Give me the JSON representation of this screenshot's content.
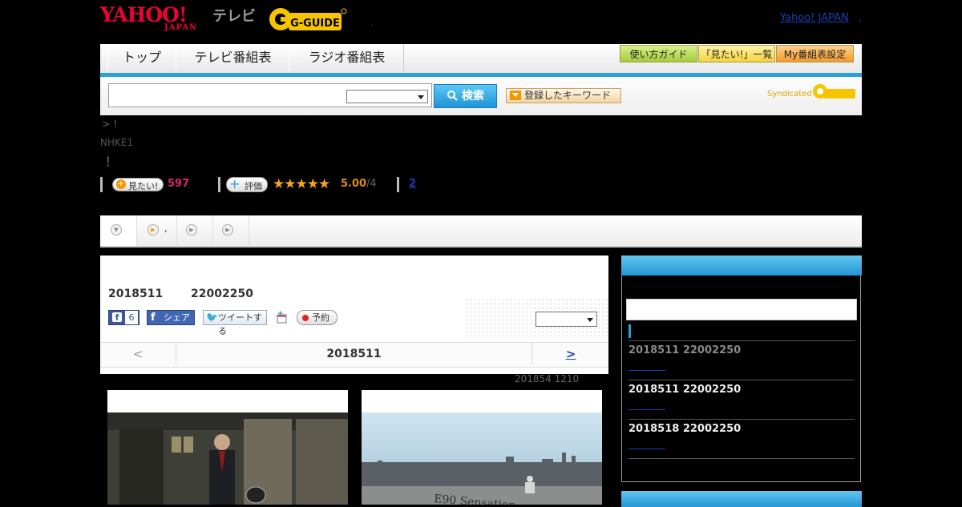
{
  "header": {
    "yahoo_logo": "YAHOO!",
    "yahoo_sub": "JAPAN",
    "tv_label": "テレビ",
    "gguide_logo": "G-GUIDE",
    "yahoo_japan_link": "Yahoo! JAPAN",
    "dot": ",",
    "dot2": ","
  },
  "nav": {
    "tabs": [
      "トップ",
      "テレビ番組表",
      "ラジオ番組表"
    ],
    "buttons": [
      "使い方ガイド",
      "「見たい!」一覧",
      "My番組表設定"
    ]
  },
  "search": {
    "button_label": "検索",
    "keyword_button": "登録したキーワード",
    "syndicated": "Syndicated"
  },
  "program": {
    "breadcrumb": "> ！",
    "channel": "NHKE1",
    "title_mark": "！",
    "want_label": "見たい!",
    "want_count": "597",
    "rate_label": "評価",
    "stars": "★★★★★",
    "rating_score": "5.00",
    "rating_count": "/4",
    "review_count": "2"
  },
  "subtabs": {
    "tab2_text": ","
  },
  "episode": {
    "air_date": "2018511",
    "air_time": "22002250",
    "fb_count": "6",
    "share_label": "シェア",
    "tweet_label": "ツイートする",
    "reserve_label": "予約",
    "prev": "<",
    "current": "2018511",
    "next": ">",
    "updated": "201854  1210"
  },
  "sidebar": {
    "entries": [
      {
        "date": "2018511  22002250",
        "active": false
      },
      {
        "date": "2018511  22002250",
        "active": true
      },
      {
        "date": "2018518  22002250",
        "active": true
      }
    ]
  },
  "colors": {
    "accent_blue": "#2aa0dc",
    "yahoo_red": "#f00033",
    "want_pink": "#e0207a",
    "star_orange": "#f3a521"
  }
}
